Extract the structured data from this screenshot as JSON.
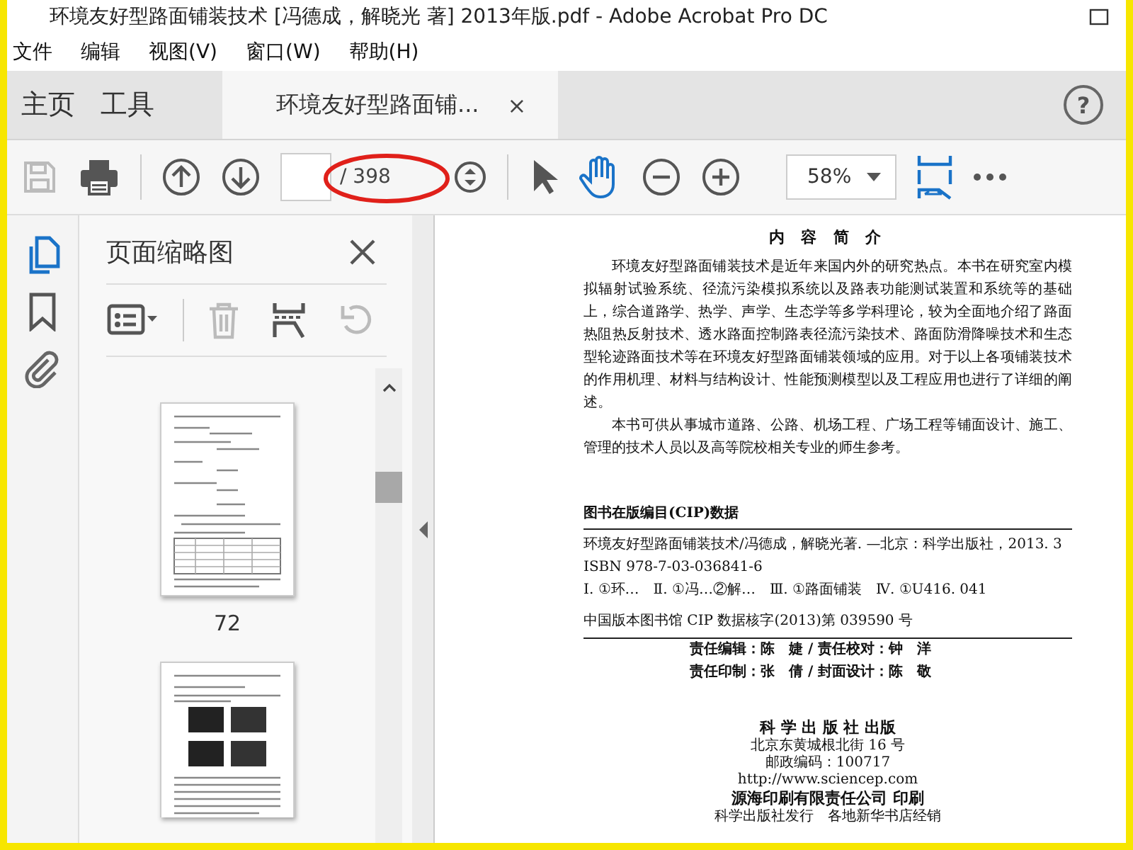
{
  "window": {
    "title": "环境友好型路面铺装技术 [冯德成，解晓光 著] 2013年版.pdf - Adobe Acrobat Pro DC"
  },
  "menu": [
    "文件",
    "编辑",
    "视图(V)",
    "窗口(W)",
    "帮助(H)"
  ],
  "tabs": [
    {
      "kind": "nav",
      "label": "主页",
      "selected": false
    },
    {
      "kind": "nav",
      "label": "工具",
      "selected": false
    },
    {
      "kind": "document",
      "label": "环境友好型路面铺...",
      "close": "×",
      "selected": true
    }
  ],
  "help": "?",
  "toolbar": {
    "page_total": "/ 398",
    "zoom": "58%"
  },
  "rail": [
    {
      "kind": "pages",
      "selected": true
    },
    {
      "kind": "bookmarks",
      "selected": false
    },
    {
      "kind": "attachments",
      "selected": false
    }
  ],
  "panel": {
    "title": "页面缩略图",
    "tools": [
      {
        "kind": "options",
        "disabled": false
      },
      {
        "kind": "delete",
        "disabled": true
      },
      {
        "kind": "extract",
        "disabled": false
      },
      {
        "kind": "rotate",
        "disabled": true
      }
    ],
    "thumbnails": [
      {
        "kind": "formulas",
        "label": "72"
      },
      {
        "kind": "photos"
      }
    ]
  },
  "document": {
    "heading": "内 容 简 介",
    "paragraphs": [
      "环境友好型路面铺装技术是近年来国内外的研究热点。本书在研究室内模拟辐射试验系统、径流污染模拟系统以及路表功能测试装置和系统等的基础上，综合道路学、热学、声学、生态学等多学科理论，较为全面地介绍了路面热阻热反射技术、透水路面控制路表径流污染技术、路面防滑降噪技术和生态型轮迹路面技术等在环境友好型路面铺装领域的应用。对于以上各项铺装技术的作用机理、材料与结构设计、性能预测模型以及工程应用也进行了详细的阐述。",
      "本书可供从事城市道路、公路、机场工程、广场工程等铺面设计、施工、管理的技术人员以及高等院校相关专业的师生参考。"
    ],
    "cip_heading": "图书在版编目(CIP)数据",
    "cip_lines": [
      "环境友好型路面铺装技术/冯德成，解晓光著. —北京：科学出版社，2013. 3",
      "ISBN 978-7-03-036841-6",
      "Ⅰ. ①环…　Ⅱ. ①冯…②解…　Ⅲ. ①路面铺装　Ⅳ. ①U416. 041"
    ],
    "cip_number": "中国版本图书馆 CIP 数据核字(2013)第 039590 号",
    "credits": [
      "责任编辑：陈　婕 / 责任校对：钟　洋",
      "责任印制：张　倩 / 封面设计：陈　敬"
    ],
    "publisher": [
      "科 学 出 版 社 出版",
      "北京东黄城根北街 16 号",
      "邮政编码：100717",
      "http://www.sciencep.com",
      "源海印刷有限责任公司 印刷",
      "科学出版社发行　各地新华书店经销"
    ]
  }
}
